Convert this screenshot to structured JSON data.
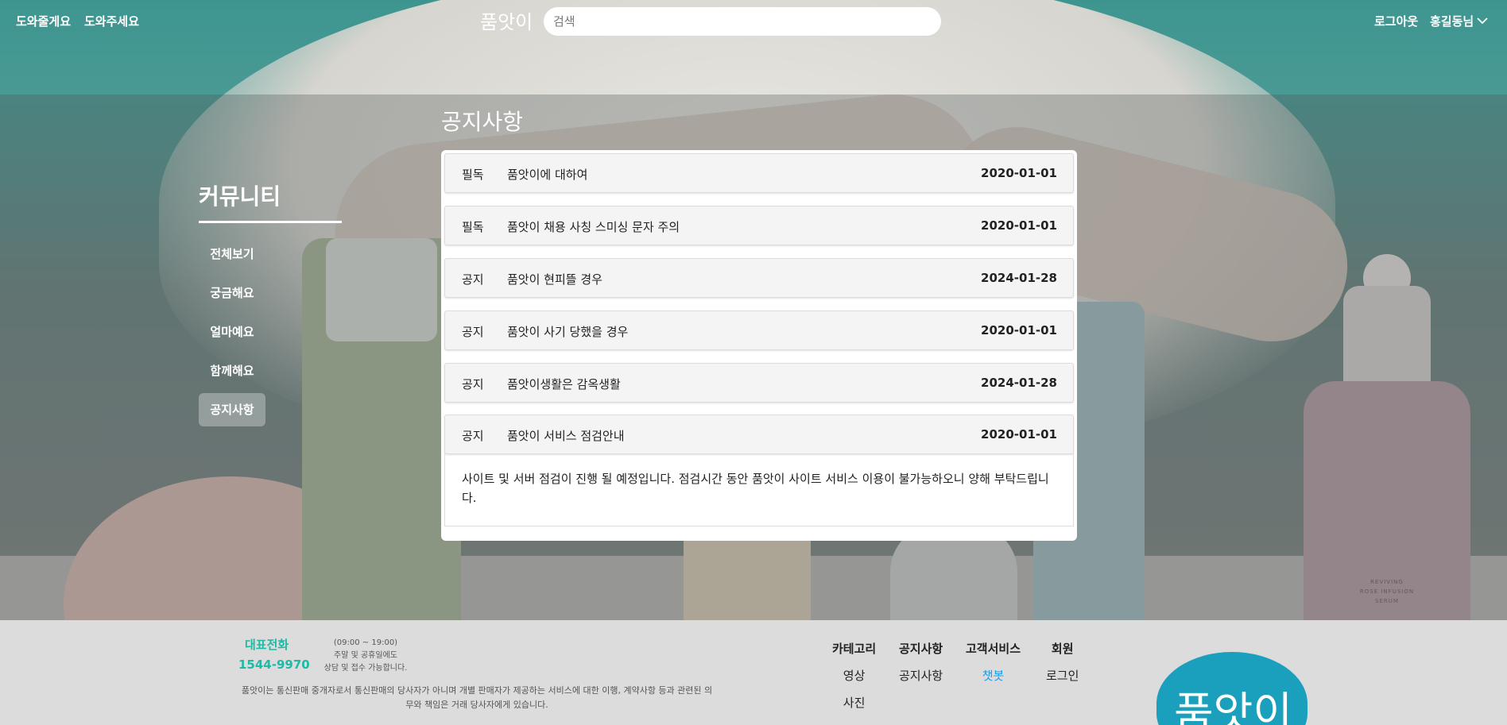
{
  "header": {
    "left_links": [
      "도와줄게요",
      "도와주세요"
    ],
    "logo": "품앗이",
    "search_placeholder": "검색",
    "logout": "로그아웃",
    "user": "홍길동님"
  },
  "sidebar": {
    "title": "커뮤니티",
    "items": [
      {
        "label": "전체보기",
        "active": false
      },
      {
        "label": "궁금해요",
        "active": false
      },
      {
        "label": "얼마예요",
        "active": false
      },
      {
        "label": "함께해요",
        "active": false
      },
      {
        "label": "공지사항",
        "active": true
      }
    ]
  },
  "main": {
    "title": "공지사항",
    "notices": [
      {
        "tag": "필독",
        "title": "품앗이에 대하여",
        "date": "2020-01-01"
      },
      {
        "tag": "필독",
        "title": "품앗이 채용 사칭 스미싱 문자 주의",
        "date": "2020-01-01"
      },
      {
        "tag": "공지",
        "title": "품앗이 현피뜰 경우",
        "date": "2024-01-28"
      },
      {
        "tag": "공지",
        "title": "품앗이 사기 당했을 경우",
        "date": "2020-01-01"
      },
      {
        "tag": "공지",
        "title": "품앗이생활은 감옥생활",
        "date": "2024-01-28"
      },
      {
        "tag": "공지",
        "title": "품앗이 서비스 점검안내",
        "date": "2020-01-01"
      }
    ],
    "expanded_detail": "사이트 및 서버 점검이 진행 될 예정입니다. 점검시간 동안 품앗이 사이트 서비스 이용이 불가능하오니 양해 부탁드립니다."
  },
  "footer": {
    "tel_label": "대표전화",
    "tel": "1544-9970",
    "hours": [
      "(09:00 ~ 19:00)",
      "주말 및 공휴일에도",
      "상담 및 접수 가능합니다."
    ],
    "desc": "품앗이는 통신판매 중개자로서 통신판매의 당사자가 아니며 개별 판매자가 제공하는 서비스에 대한 이행, 계약사항 등과 관련된 의무와 책임은 거래 당사자에게 있습니다.",
    "columns": [
      {
        "head": "카테고리",
        "links": [
          "영상",
          "사진"
        ]
      },
      {
        "head": "공지사항",
        "links": [
          "공지사항"
        ]
      },
      {
        "head": "고객서비스",
        "links": [
          "챗봇"
        ]
      },
      {
        "head": "회원",
        "links": [
          "로그인"
        ]
      }
    ],
    "logo": "품앗이"
  },
  "background": {
    "product_label": [
      "REVIVING",
      "ROSE INFUSION",
      "SERUM"
    ]
  },
  "colors": {
    "accent": "#20b9a6",
    "link_accent": "#1e9be8"
  }
}
